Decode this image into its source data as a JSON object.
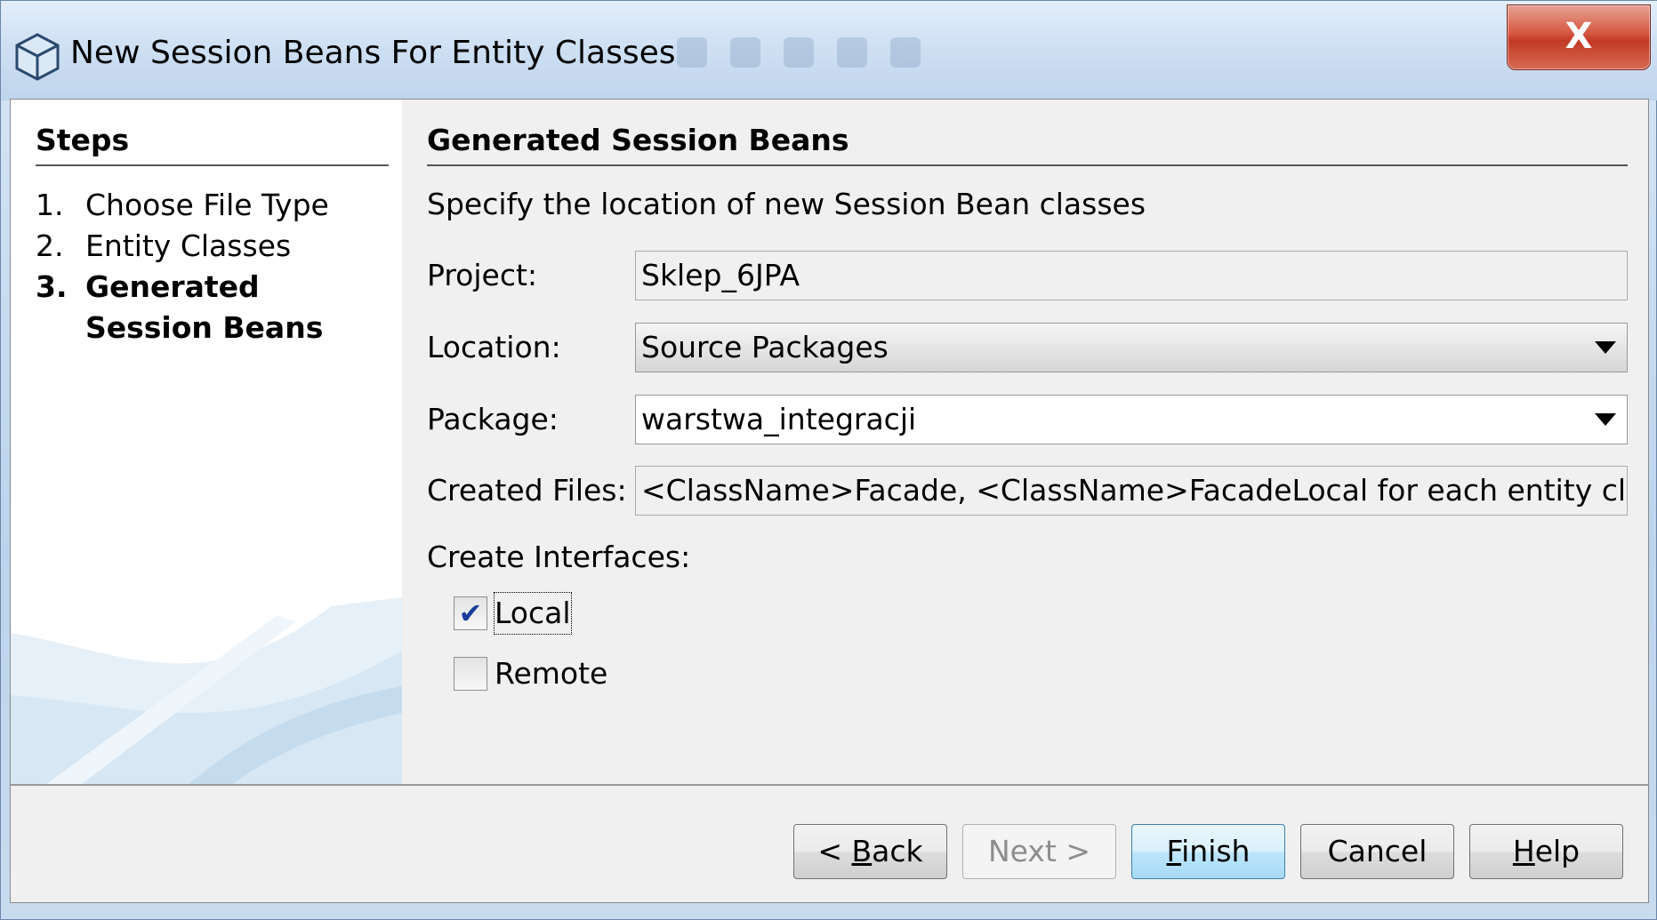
{
  "window": {
    "title": "New Session Beans For Entity Classes",
    "close_label": "X"
  },
  "steps": {
    "heading": "Steps",
    "items": [
      {
        "num": "1.",
        "label": "Choose File Type"
      },
      {
        "num": "2.",
        "label": "Entity Classes"
      },
      {
        "num": "3.",
        "label": "Generated Session Beans",
        "current": true
      }
    ]
  },
  "panel": {
    "heading": "Generated Session Beans",
    "description": "Specify the location of new Session Bean classes",
    "project": {
      "label": "Project:",
      "value": "Sklep_6JPA"
    },
    "location": {
      "label": "Location:",
      "value": "Source Packages"
    },
    "package": {
      "label": "Package:",
      "value": "warstwa_integracji"
    },
    "created_files": {
      "label": "Created Files:",
      "value": "<ClassName>Facade, <ClassName>FacadeLocal for each entity class."
    },
    "interfaces": {
      "label": "Create Interfaces:",
      "local": {
        "label": "Local",
        "checked": true
      },
      "remote": {
        "label": "Remote",
        "checked": false
      }
    }
  },
  "buttons": {
    "back": {
      "prefix": "< ",
      "mnemonic": "B",
      "rest": "ack"
    },
    "next": "Next >",
    "finish": {
      "mnemonic": "F",
      "rest": "inish"
    },
    "cancel": "Cancel",
    "help": {
      "mnemonic": "H",
      "rest": "elp"
    }
  },
  "colors": {
    "check_mark": "#1a3f9a",
    "close_button": "#c13a24",
    "default_button_border": "#3c7fb1"
  }
}
